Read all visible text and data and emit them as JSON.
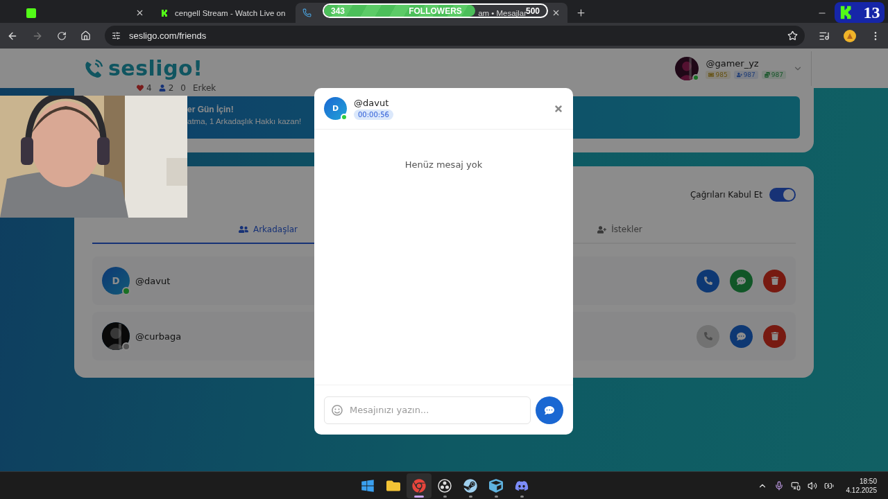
{
  "browser": {
    "tabs": [
      {
        "selected": false,
        "kind": "green"
      },
      {
        "title": "cengell Stream - Watch Live on",
        "selected": false,
        "kind": "kick"
      },
      {
        "title": "am • Mesajlar",
        "selected": true,
        "kind": "phone"
      }
    ],
    "url": "sesligo.com/friends"
  },
  "stream_overlay": {
    "current": "343",
    "label": "FOLLOWERS",
    "goal": "500",
    "level": 0.68,
    "badge": "13"
  },
  "header": {
    "logo": "sesligo!",
    "user": {
      "name": "@gamer_yz",
      "online": true,
      "stats": [
        {
          "value": "985",
          "kind": "tickets"
        },
        {
          "value": "987",
          "kind": "friends"
        },
        {
          "value": "987",
          "kind": "coins"
        }
      ]
    }
  },
  "summary": {
    "stats": [
      {
        "value": "4",
        "kind": "heart"
      },
      {
        "value": "2",
        "kind": "user"
      },
      {
        "value": "0",
        "kind": "plain"
      }
    ],
    "gender": "Erkek",
    "banner": {
      "title": "er Gün İçin!",
      "text": "atma, 1 Arkadaşlık Hakkı kazan!"
    }
  },
  "friends": {
    "accept_calls": {
      "label": "Çağrıları Kabul Et",
      "on": true
    },
    "tabs": [
      {
        "label": "Arkadaşlar",
        "selected": true,
        "kind": "friends"
      },
      {
        "label": "İstekler",
        "selected": false,
        "kind": "requests"
      }
    ],
    "rows": [
      {
        "name": "@davut",
        "initial": "D",
        "kind": "initial",
        "online": true,
        "chat_open": true
      },
      {
        "name": "@curbaga",
        "online": false,
        "chat_open": false
      }
    ]
  },
  "chat": {
    "user": "@davut",
    "initial": "D",
    "online": true,
    "timer": "00:00:56",
    "empty": "Henüz mesaj yok",
    "placeholder": "Mesajınızı yazın..."
  },
  "taskbar": {
    "apps": [
      {
        "kind": "start",
        "active": false
      },
      {
        "kind": "folder",
        "active": false
      },
      {
        "kind": "browser",
        "active": true
      },
      {
        "kind": "obs",
        "active": false
      },
      {
        "kind": "steam",
        "active": false
      },
      {
        "kind": "cube",
        "active": false
      },
      {
        "kind": "discord",
        "active": false
      }
    ],
    "time": "18:50",
    "date": "4.12.2025"
  }
}
